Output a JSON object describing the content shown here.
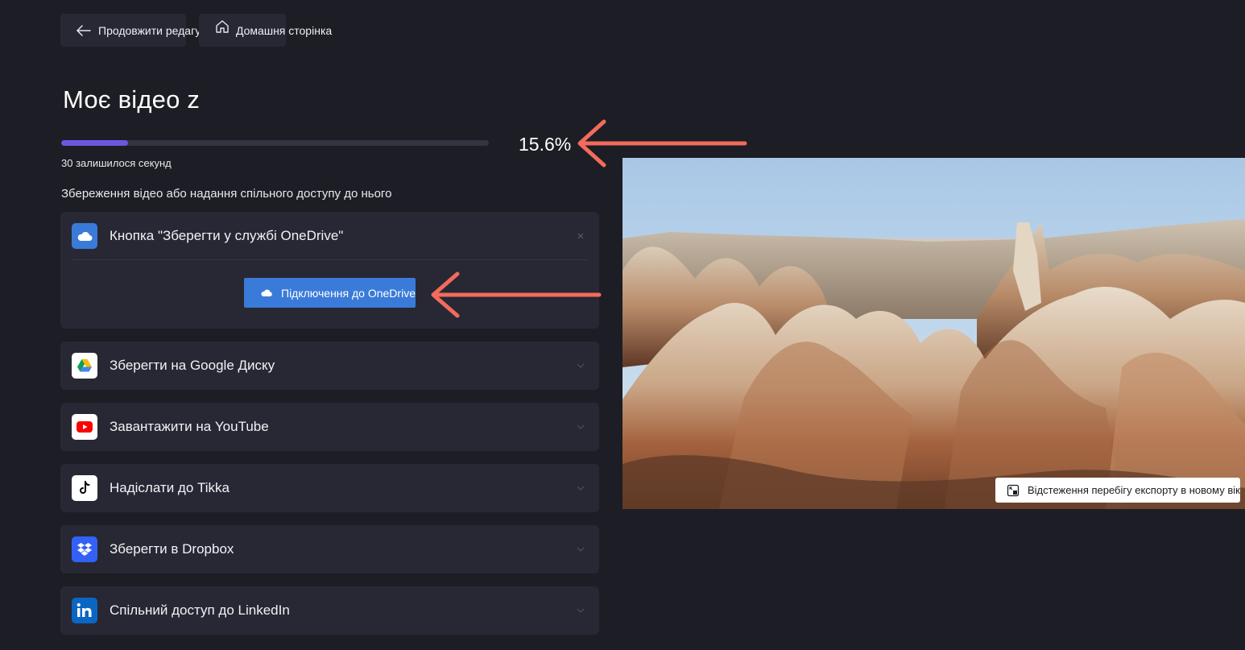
{
  "header": {
    "back_label": "Продовжити редагування",
    "home_label": "Домашня сторінка"
  },
  "project": {
    "title": "Моє відео z"
  },
  "progress": {
    "percent_text": "15.6%",
    "fraction": 0.156,
    "remaining_number": "30",
    "remaining_text": "залишилося секунд",
    "bar_color": "#6a58e0"
  },
  "share": {
    "section_label": "Збереження відео або надання спільного доступу до нього",
    "onedrive": {
      "label": "Кнопка \"Зберегти у службі OneDrive\"",
      "connect_label": "Підключення до OneDrive",
      "icon": "cloud-icon",
      "color": "#3a7bd9"
    },
    "items": [
      {
        "label": "Зберегти на Google Диску",
        "icon": "google-drive-icon"
      },
      {
        "label": "Завантажити на YouTube",
        "icon": "youtube-icon"
      },
      {
        "label": "Надіслати до Tikka",
        "icon": "tiktok-icon"
      },
      {
        "label": "Зберегти в Dropbox",
        "icon": "dropbox-icon"
      },
      {
        "label": "Спільний доступ до LinkedIn",
        "icon": "linkedin-icon"
      }
    ]
  },
  "preview": {
    "track_label": "Відстеження перебігу експорту в новому вікні"
  },
  "colors": {
    "background": "#1d1d25",
    "card": "#272833",
    "annotation_arrow": "#f26b5b"
  }
}
